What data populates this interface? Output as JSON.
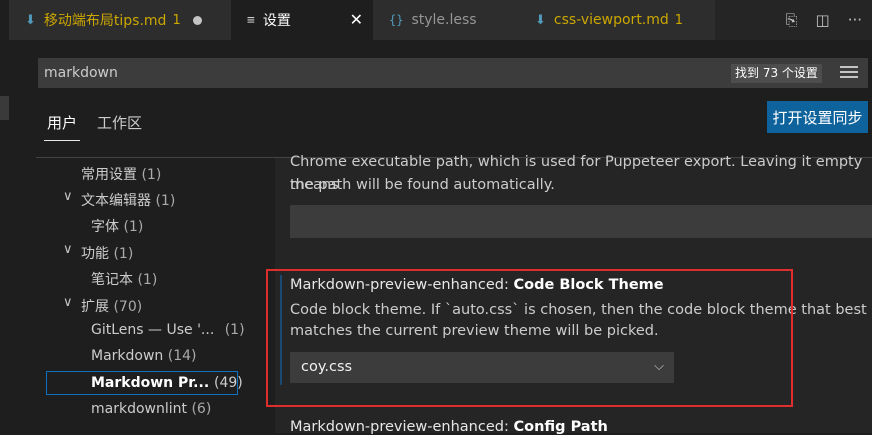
{
  "tabs": [
    {
      "title": "移动端布局tips.md",
      "badge": "1",
      "icon": "markdown-icon"
    },
    {
      "title": "设置",
      "icon": "settings-lines-icon"
    },
    {
      "title": "style.less",
      "icon": "less-braces-icon"
    },
    {
      "title": "css-viewport.md",
      "badge": "1",
      "icon": "markdown-icon"
    }
  ],
  "search": {
    "value": "markdown",
    "result_count": "找到 73 个设置"
  },
  "scope": {
    "user": "用户",
    "workspace": "工作区",
    "sync_button": "打开设置同步"
  },
  "tree": [
    {
      "label": "常用设置",
      "count": "(1)"
    },
    {
      "label": "文本编辑器",
      "count": "(1)",
      "chevron": "∨"
    },
    {
      "label": "字体",
      "count": "(1)"
    },
    {
      "label": "功能",
      "count": "(1)",
      "chevron": "∨"
    },
    {
      "label": "笔记本",
      "count": "(1)"
    },
    {
      "label": "扩展",
      "count": "(70)",
      "chevron": "∨"
    },
    {
      "label": "GitLens — Use '...",
      "count": "(1)"
    },
    {
      "label": "Markdown",
      "count": "(14)"
    },
    {
      "label": "Markdown Pr...",
      "count": "(49)"
    },
    {
      "label": "markdownlint",
      "count": "(6)"
    }
  ],
  "settings": {
    "prev_desc_line1": "Chrome executable path, which is used for Puppeteer export. Leaving it empty means",
    "prev_desc_line2": "the path will be found automatically.",
    "code_block": {
      "prefix": "Markdown-preview-enhanced: ",
      "name": "Code Block Theme",
      "desc_line1": "Code block theme. If `auto.css` is chosen, then the code block theme that best",
      "desc_line2": "matches the current preview theme will be picked.",
      "value": "coy.css"
    },
    "next": {
      "prefix": "Markdown-preview-enhanced: ",
      "name": "Config Path"
    }
  },
  "colors": {
    "accent": "#0e639c",
    "highlight_border": "#e02d2d",
    "warning": "#cca700"
  }
}
